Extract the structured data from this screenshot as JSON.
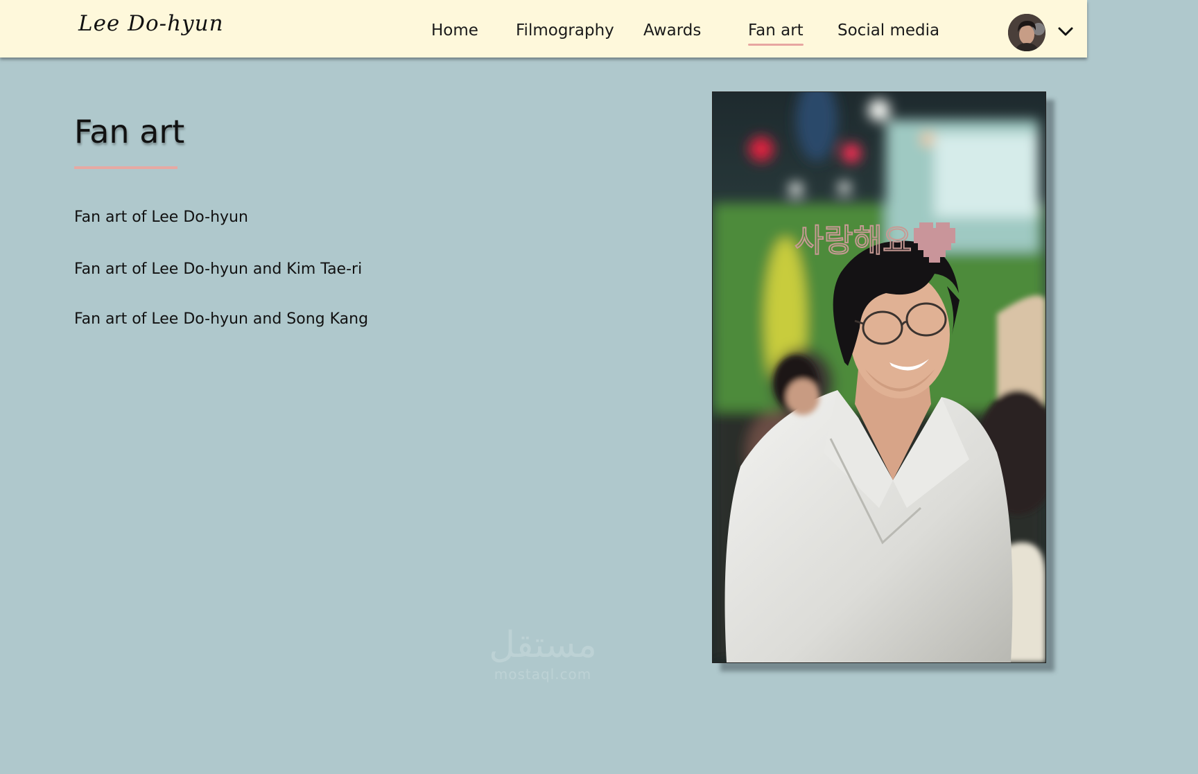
{
  "header": {
    "logo": "Lee Do-hyun",
    "nav": [
      {
        "label": "Home"
      },
      {
        "label": "Filmography"
      },
      {
        "label": "Awards"
      },
      {
        "label": "Fan art",
        "active": true
      },
      {
        "label": "Social media"
      }
    ],
    "avatar_icon": "user-avatar",
    "menu_icon": "chevron-down-icon"
  },
  "main": {
    "title": "Fan art",
    "links": [
      "Fan art of Lee Do-hyun",
      "Fan art of Lee Do-hyun and Kim Tae-ri",
      "Fan art of Lee Do-hyun and Song Kang"
    ],
    "photo": {
      "overlay_text": "사랑해요",
      "overlay_icon": "pixel-heart-icon"
    }
  },
  "watermark": {
    "arabic": "مستقل",
    "latin": "mostaql.com"
  },
  "colors": {
    "header_bg": "#fef8db",
    "page_bg": "#afc8cc",
    "accent": "#e6a9a3"
  }
}
